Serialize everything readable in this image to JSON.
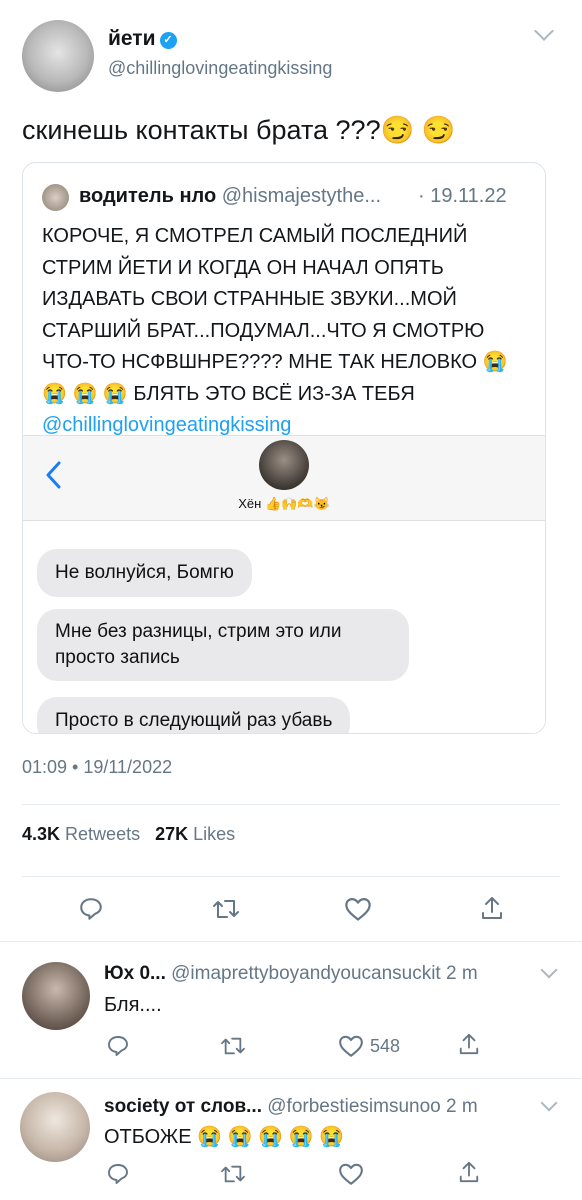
{
  "main_tweet": {
    "display_name": "йети",
    "handle": "@chillinglovingeatingkissing",
    "text": "скинешь контакты брата ???😏 😏"
  },
  "quoted_tweet": {
    "display_name": "водитель нло",
    "handle": "@hismajestythe...",
    "date": "· 19.11.22",
    "text": "КОРОЧЕ, Я СМОТРЕЛ САМЫЙ ПОСЛЕДНИЙ СТРИМ ЙЕТИ И КОГДА ОН НАЧАЛ ОПЯТЬ ИЗДАВАТЬ СВОИ СТРАННЫЕ ЗВУКИ...МОЙ СТАРШИЙ БРАТ...ПОДУМАЛ...ЧТО Я СМОТРЮ ЧТО-ТО НСФВШНРЕ???? МНЕ ТАК НЕЛОВКО 😭 😭 😭 😭 БЛЯТЬ ЭТО ВСЁ ИЗ-ЗА ТЕБЯ ",
    "mention": "@chillinglovingeatingkissing",
    "chat": {
      "contact_name": "Хён 👍🙌🫶😼",
      "messages": [
        "Не волнуйся, Бомгю",
        "Мне без разницы, стрим это или просто запись",
        "Просто в следующий раз убавь"
      ]
    }
  },
  "timestamp": "01:09 • 19/11/2022",
  "stats": {
    "retweets_count": "4.3K",
    "retweets_label": "Retweets",
    "likes_count": "27K",
    "likes_label": "Likes"
  },
  "replies": [
    {
      "display_name": "Юх 0...",
      "handle": "@imaprettyboyandyoucansuckit",
      "time": "2 m",
      "text": "Бля....",
      "likes": "548"
    },
    {
      "display_name": "society от слов...",
      "handle": "@forbestiesimsunoo",
      "time": "2 m",
      "text": "ОТБОЖЕ 😭 😭 😭 😭 😭",
      "likes": ""
    }
  ],
  "colors": {
    "accent": "#1da1f2",
    "muted": "#657786",
    "bubble": "#e9e9eb"
  },
  "icons": [
    "verified-icon",
    "chevron-down-icon",
    "back-chevron-icon",
    "reply-icon",
    "retweet-icon",
    "like-icon",
    "share-icon"
  ]
}
